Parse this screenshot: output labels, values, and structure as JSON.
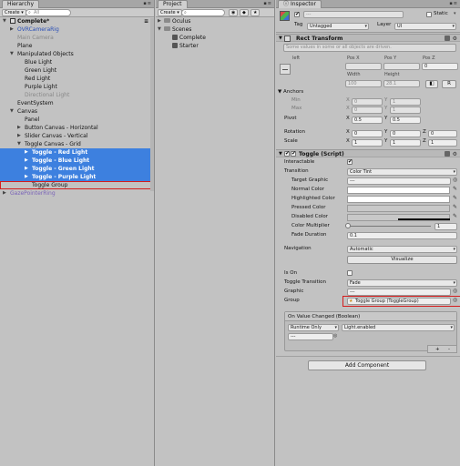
{
  "hierarchy": {
    "tab": "Hierarchy",
    "create": "Create",
    "search_placeholder": "All",
    "rows": [
      {
        "label": "Complete*",
        "indent": 0,
        "arrow": "▼",
        "style": "scene"
      },
      {
        "label": "OVRCameraRig",
        "indent": 1,
        "arrow": "▶",
        "style": "blue"
      },
      {
        "label": "Main Camera",
        "indent": 1,
        "arrow": "",
        "style": "gray"
      },
      {
        "label": "Plane",
        "indent": 1,
        "arrow": "",
        "style": ""
      },
      {
        "label": "Manipulated Objects",
        "indent": 1,
        "arrow": "▼",
        "style": ""
      },
      {
        "label": "Blue Light",
        "indent": 2,
        "arrow": "",
        "style": ""
      },
      {
        "label": "Green Light",
        "indent": 2,
        "arrow": "",
        "style": ""
      },
      {
        "label": "Red Light",
        "indent": 2,
        "arrow": "",
        "style": ""
      },
      {
        "label": "Purple Light",
        "indent": 2,
        "arrow": "",
        "style": ""
      },
      {
        "label": "Directional Light",
        "indent": 2,
        "arrow": "",
        "style": "gray"
      },
      {
        "label": "EventSystem",
        "indent": 1,
        "arrow": "",
        "style": ""
      },
      {
        "label": "Canvas",
        "indent": 1,
        "arrow": "▼",
        "style": ""
      },
      {
        "label": "Panel",
        "indent": 2,
        "arrow": "",
        "style": ""
      },
      {
        "label": "Button Canvas - Horizontal",
        "indent": 2,
        "arrow": "▶",
        "style": ""
      },
      {
        "label": "Slider Canvas - Vertical",
        "indent": 2,
        "arrow": "▶",
        "style": ""
      },
      {
        "label": "Toggle Canvas - Grid",
        "indent": 2,
        "arrow": "▼",
        "style": ""
      },
      {
        "label": "Toggle - Red Light",
        "indent": 3,
        "arrow": "▶",
        "style": "sel"
      },
      {
        "label": "Toggle - Blue Light",
        "indent": 3,
        "arrow": "▶",
        "style": "sel"
      },
      {
        "label": "Toggle - Green Light",
        "indent": 3,
        "arrow": "▶",
        "style": "sel"
      },
      {
        "label": "Toggle - Purple Light",
        "indent": 3,
        "arrow": "▶",
        "style": "sel"
      },
      {
        "label": "Toggle Group",
        "indent": 3,
        "arrow": "",
        "style": "boxed"
      },
      {
        "label": "GazePointerRing",
        "indent": 0,
        "arrow": "▶",
        "style": "purple"
      }
    ]
  },
  "project": {
    "tab": "Project",
    "create": "Create",
    "rows": [
      {
        "label": "Oculus",
        "indent": 0,
        "arrow": "▶",
        "icon": "folder"
      },
      {
        "label": "Scenes",
        "indent": 0,
        "arrow": "▼",
        "icon": "folder"
      },
      {
        "label": "Complete",
        "indent": 1,
        "arrow": "",
        "icon": "scene"
      },
      {
        "label": "Starter",
        "indent": 1,
        "arrow": "",
        "icon": "scene"
      }
    ]
  },
  "inspector": {
    "tab": "Inspector",
    "name_value": "---",
    "static_label": "Static",
    "tag_label": "Tag",
    "tag_value": "Untagged",
    "layer_label": "Layer",
    "layer_value": "UI",
    "rect_transform": {
      "title": "Rect Transform",
      "note": "Some values in some or all objects are driven.",
      "anchor_preset": "left",
      "pos_x_label": "Pos X",
      "pos_y_label": "Pos Y",
      "pos_z_label": "Pos Z",
      "pos_x": "",
      "pos_y": "",
      "pos_z": "0",
      "width_label": "Width",
      "height_label": "Height",
      "width": "100",
      "height": "28.1",
      "r_button": "R",
      "anchors_label": "Anchors",
      "min_label": "Min",
      "max_label": "Max",
      "min_x": "0",
      "min_y": "1",
      "max_x": "0",
      "max_y": "1",
      "pivot_label": "Pivot",
      "pivot_x": "0.5",
      "pivot_y": "0.5",
      "rotation_label": "Rotation",
      "rot_x": "0",
      "rot_y": "0",
      "rot_z": "0",
      "scale_label": "Scale",
      "scale_x": "1",
      "scale_y": "1",
      "scale_z": "1"
    },
    "toggle": {
      "title": "Toggle (Script)",
      "interactable_label": "Interactable",
      "transition_label": "Transition",
      "transition_value": "Color Tint",
      "target_graphic_label": "Target Graphic",
      "target_graphic_value": "---",
      "normal_color_label": "Normal Color",
      "highlighted_color_label": "Highlighted Color",
      "pressed_color_label": "Pressed Color",
      "disabled_color_label": "Disabled Color",
      "color_multiplier_label": "Color Multiplier",
      "color_multiplier_value": "1",
      "fade_duration_label": "Fade Duration",
      "fade_duration_value": "0.1",
      "navigation_label": "Navigation",
      "navigation_value": "Automatic",
      "visualize_label": "Visualize",
      "is_on_label": "Is On",
      "toggle_transition_label": "Toggle Transition",
      "toggle_transition_value": "Fade",
      "graphic_label": "Graphic",
      "graphic_value": "---",
      "group_label": "Group",
      "group_value": "Toggle Group (ToggleGroup)",
      "event_title": "On Value Changed (Boolean)",
      "runtime_value": "Runtime Only",
      "function_value": "Light.enabled",
      "object_value": "---",
      "plus": "+",
      "minus": "-"
    },
    "add_component": "Add Component"
  }
}
